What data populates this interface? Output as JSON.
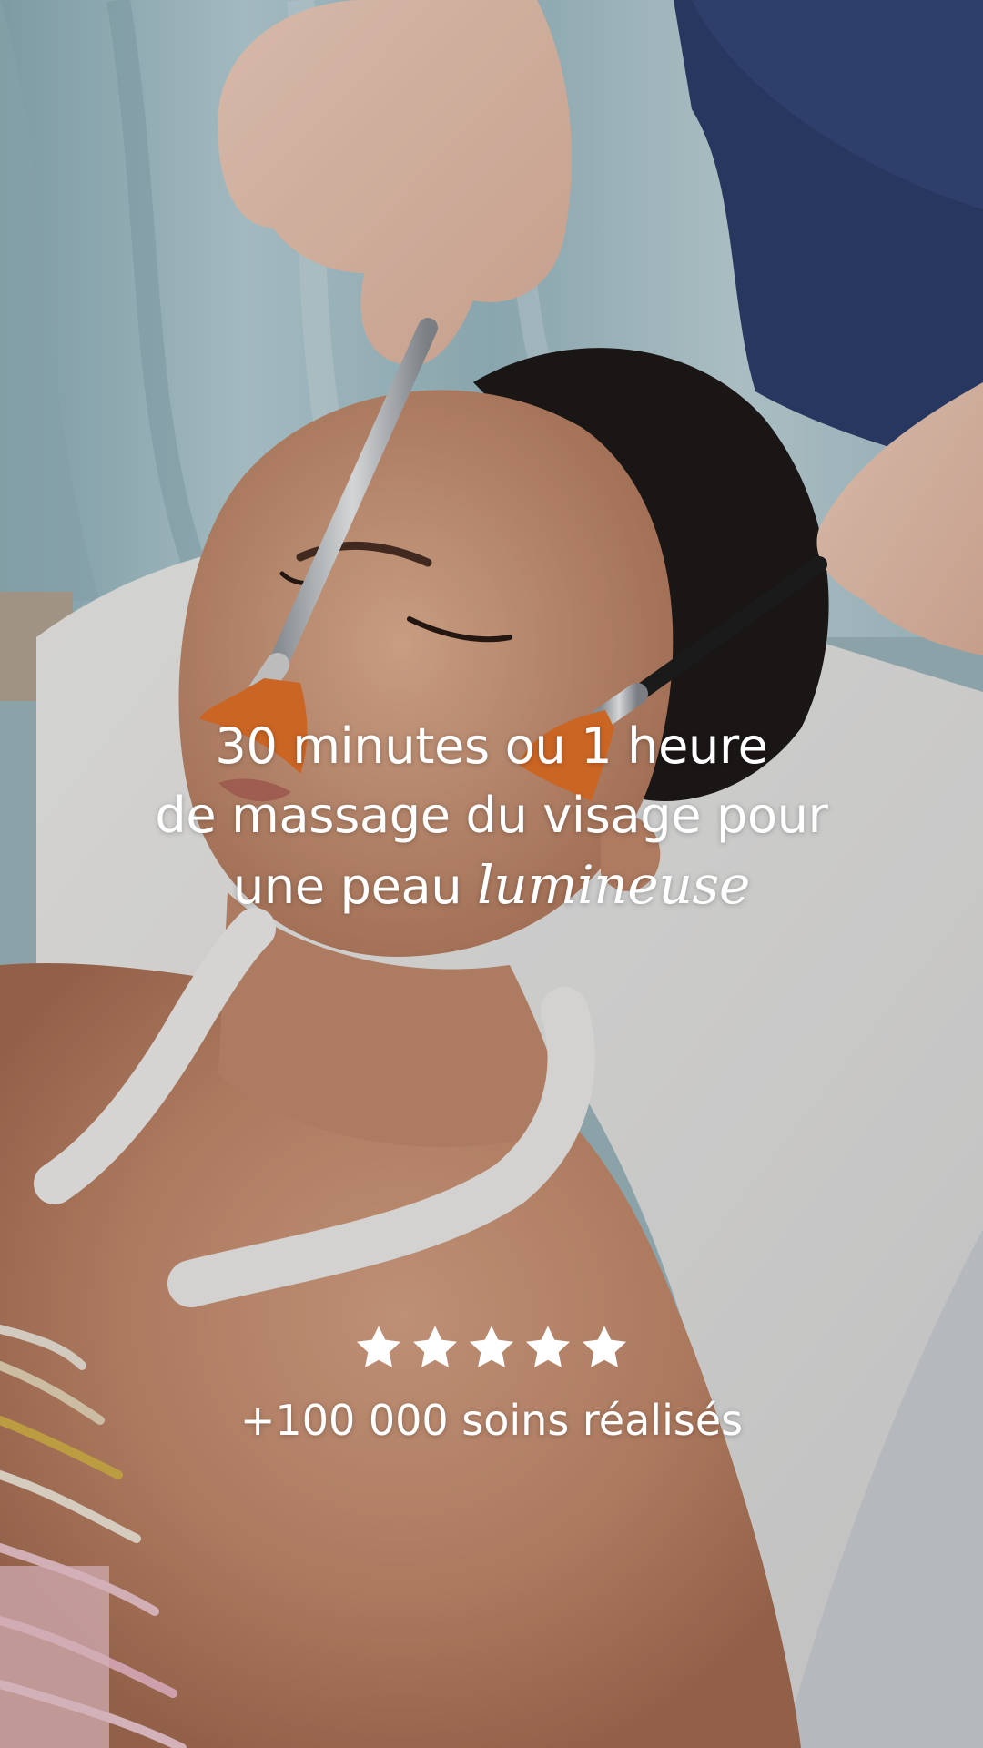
{
  "scene": {
    "description_icon": "facial-treatment-photo"
  },
  "headline": {
    "line1": "30 minutes ou 1 heure",
    "line2": "de massage du visage pour",
    "line3_prefix": "une peau ",
    "line3_accent": "lumineuse"
  },
  "rating": {
    "stars": 5,
    "caption": "+100 000 soins réalisés"
  },
  "colors": {
    "text": "#ffffff",
    "brush_bristles": "#e8742a",
    "curtain": "#a9c6cf",
    "shirt": "#2e3f6e"
  }
}
